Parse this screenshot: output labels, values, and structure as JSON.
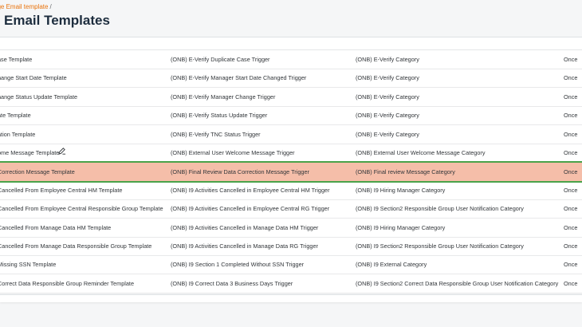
{
  "breadcrumb": {
    "item": "age Email template",
    "sep": "/"
  },
  "page_title": "Email Templates",
  "table": {
    "rows": [
      {
        "template": "ase Template",
        "trigger": "(ONB) E-Verify Duplicate Case Trigger",
        "category": "(ONB) E-Verify Category",
        "frequency": "Once"
      },
      {
        "template": "hange Start Date Template",
        "trigger": "(ONB) E-Verify Manager Start Date Changed Trigger",
        "category": "(ONB) E-Verify Category",
        "frequency": "Once"
      },
      {
        "template": "hange Status Update Template",
        "trigger": "(ONB) E-Verify Manager Change Trigger",
        "category": "(ONB) E-Verify Category",
        "frequency": "Once"
      },
      {
        "template": "ate Template",
        "trigger": "(ONB) E-Verify Status Update Trigger",
        "category": "(ONB) E-Verify Category",
        "frequency": "Once"
      },
      {
        "template": "ation Template",
        "trigger": "(ONB) E-Verify TNC Status Trigger",
        "category": "(ONB) E-Verify Category",
        "frequency": "Once"
      },
      {
        "template": "ome Message Template",
        "trigger": "(ONB) External User Welcome Message Trigger",
        "category": "(ONB) External User Welcome Message Category",
        "frequency": "Once"
      },
      {
        "template": "Correction Message Template",
        "trigger": "(ONB) Final Review Data Correction Message Trigger",
        "category": "(ONB) Final review Message Category",
        "frequency": "Once"
      },
      {
        "template": "Cancelled From Employee Central HM Template",
        "trigger": "(ONB) I9 Activities Cancelled in Employee Central HM Trigger",
        "category": "(ONB) I9 Hiring Manager Category",
        "frequency": "Once"
      },
      {
        "template": "Cancelled From Employee Central Responsible Group Template",
        "trigger": "(ONB) I9 Activities Cancelled in Employee Central RG Trigger",
        "category": "(ONB) I9 Section2 Responsible Group User Notification Category",
        "frequency": "Once"
      },
      {
        "template": "Cancelled From Manage Data HM Template",
        "trigger": "(ONB) I9 Activities Cancelled in Manage Data HM Trigger",
        "category": "(ONB) I9 Hiring Manager Category",
        "frequency": "Once"
      },
      {
        "template": "Cancelled From Manage Data Responsible Group Template",
        "trigger": "(ONB) I9 Activities Cancelled in Manage Data RG Trigger",
        "category": "(ONB) I9 Section2 Responsible Group User Notification Category",
        "frequency": "Once"
      },
      {
        "template": "Missing SSN Template",
        "trigger": "(ONB) I9 Section 1 Completed Without SSN Trigger",
        "category": "(ONB) I9 External Category",
        "frequency": "Once"
      },
      {
        "template": "Correct Data Responsible Group Reminder Template",
        "trigger": "(ONB) I9 Correct Data 3 Business Days Trigger",
        "category": "(ONB) I9 Section2 Correct Data Responsible Group User Notification Category",
        "frequency": "Once"
      }
    ],
    "selected_index": 6,
    "hover_icon": "edit-pencil-icon"
  },
  "colors": {
    "accent_breadcrumb": "#e9730c",
    "selected_row": "#f5bea9",
    "selected_border": "#4aa34a",
    "title": "#1d2d3e"
  }
}
